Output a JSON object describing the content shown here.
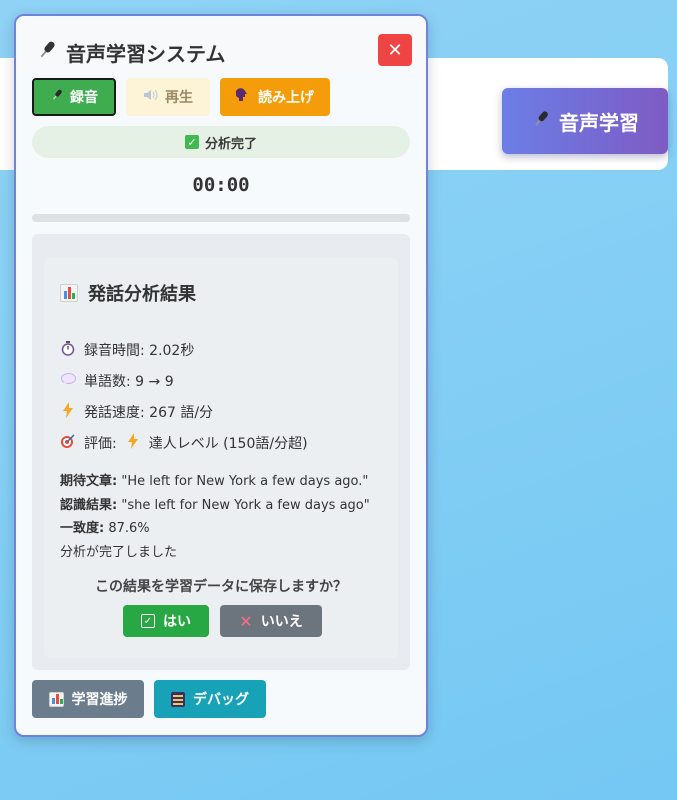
{
  "page": {
    "launch_button": {
      "label": "音声学習",
      "icon": "microphone-icon"
    }
  },
  "panel": {
    "title": "音声学習システム",
    "title_icon": "microphone-icon",
    "close_label": "✕",
    "controls": {
      "record_label": "録音",
      "play_label": "再生",
      "read_label": "読み上げ"
    },
    "status": "分析完了",
    "timer": "00:00",
    "progress_fraction": 0.0,
    "result": {
      "heading": "発話分析結果",
      "metrics": [
        {
          "icon": "stopwatch-icon",
          "text": "録音時間: 2.02秒"
        },
        {
          "icon": "speech-bubble-icon",
          "text": "単語数: 9 → 9"
        },
        {
          "icon": "lightning-icon",
          "text": "発話速度: 267 語/分"
        },
        {
          "icon": "target-icon",
          "text_prefix": "評価:",
          "text": "達人レベル (150語/分超)"
        }
      ],
      "expected_label": "期待文章:",
      "expected_value": "\"He left for New York a few days ago.\"",
      "recognized_label": "認識結果:",
      "recognized_value": "\"she left for New York a few days ago\"",
      "match_label": "一致度:",
      "match_value": "87.6%",
      "complete_message": "分析が完了しました",
      "confirm_question": "この結果を学習データに保存しますか？",
      "yes_label": "はい",
      "no_label": "いいえ"
    },
    "footer": {
      "progress_label": "学習進捗",
      "debug_label": "デバッグ"
    }
  },
  "colors": {
    "accent_green": "#3fac4f",
    "read_orange": "#f59c0b",
    "close_red": "#ef4444",
    "debug_teal": "#17a2b8",
    "launch_gradient_start": "#6b7ee6",
    "launch_gradient_end": "#7e5bc4"
  }
}
